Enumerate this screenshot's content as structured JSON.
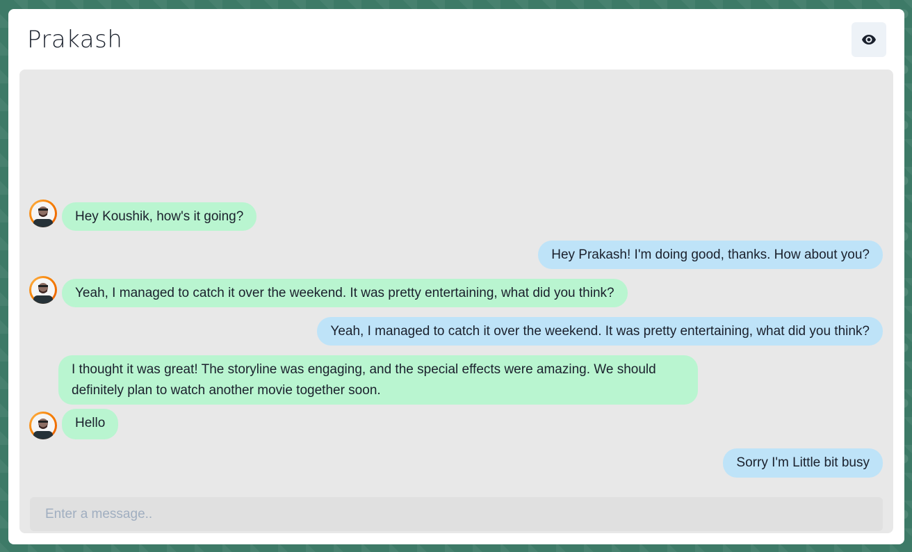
{
  "chat": {
    "title": "Prakash",
    "input_placeholder": "Enter a message..",
    "input_value": ""
  },
  "messages": [
    {
      "side": "received",
      "text": "Hey Koushik, how's it going?",
      "avatar": true
    },
    {
      "side": "sent",
      "text": "Hey Prakash! I'm doing good, thanks. How about you?"
    },
    {
      "side": "received",
      "text": "Yeah, I managed to catch it over the weekend. It was pretty entertaining, what did you think?",
      "avatar": true
    },
    {
      "side": "sent",
      "text": "Yeah, I managed to catch it over the weekend. It was pretty entertaining, what did you think?"
    },
    {
      "side": "received",
      "text": "I thought it was great! The storyline was engaging, and the special effects were amazing. We should definitely plan to watch another movie together soon.",
      "avatar": false
    },
    {
      "side": "received",
      "text": "Hello",
      "avatar": true
    },
    {
      "side": "sent",
      "text": "Sorry I'm Little bit busy"
    }
  ],
  "icons": {
    "view_profile": "eye-icon",
    "avatar": "user-avatar"
  },
  "colors": {
    "received_bubble": "#b9f5d0",
    "sent_bubble": "#bee3f8",
    "chat_background": "#e8e8e8",
    "page_background": "#3d7a67"
  }
}
